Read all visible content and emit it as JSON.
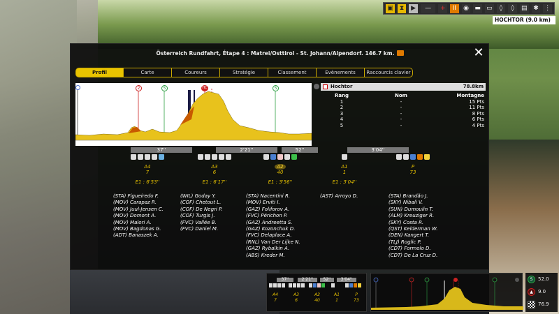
{
  "toolbar": {
    "location": "HOCHTOR (9.0 km)"
  },
  "panel": {
    "title": "Österreich Rundfahrt, Étape 4 : Matrei/Osttirol - St. Johann/Alpendorf. 146.7 km."
  },
  "tabs": [
    "Profil",
    "Carte",
    "Coureurs",
    "Stratégie",
    "Classement",
    "Evènements",
    "Raccourcis clavier"
  ],
  "active_tab": "Profil",
  "profile_markers": [
    "R",
    "2",
    "S",
    "HC",
    "S"
  ],
  "climb": {
    "name": "Hochtor",
    "distance": "78.8km",
    "columns": [
      "Rang",
      "Nom",
      "Montagne"
    ],
    "rows": [
      {
        "rank": "1",
        "name": "-",
        "points": "15 Pts"
      },
      {
        "rank": "2",
        "name": "-",
        "points": "11 Pts"
      },
      {
        "rank": "3",
        "name": "-",
        "points": "8 Pts"
      },
      {
        "rank": "4",
        "name": "-",
        "points": "6 Pts"
      },
      {
        "rank": "5",
        "name": "-",
        "points": "4 Pts"
      }
    ]
  },
  "gaps": [
    "37''",
    "2'21''",
    "52''",
    "3'04''"
  ],
  "groups": [
    {
      "code": "A4",
      "count": "7",
      "time": "E1 : 6'53''",
      "riders": [
        "(STA) Figueiredo F.",
        "(MOV) Carapaz R.",
        "(MOV) Juul-Jensen C.",
        "(MOV) Domont A.",
        "(MOV) Malori A.",
        "(MOV) Bagdonas G.",
        "(ADT) Banaszek A."
      ]
    },
    {
      "code": "A3",
      "count": "6",
      "time": "E1 : 6'17''",
      "riders": [
        "(WIL) Goday Y.",
        "(COF) Chetout L.",
        "(COF) De Negri P.",
        "(COF) Turgis J.",
        "(FVC) Vallée B.",
        "(FVC) Daniel M."
      ]
    },
    {
      "code": "A2",
      "count": "40",
      "time": "E1 : 3'56''",
      "riders": [
        "(STA) Nacentini R.",
        "(MOV) Erviti I.",
        "(GAZ) Foliforov A.",
        "(FVC) Périchon P.",
        "(GAZ) Andreetta S.",
        "(GAZ) Kozonchuk D.",
        "(FVC) Delaplace A.",
        "(RNL) Van Der Lijke N.",
        "(GAZ) Rybalkin A.",
        "(ABS) Kreder M."
      ]
    },
    {
      "code": "A1",
      "count": "1",
      "time": "E1 : 3'04''",
      "riders": [
        "(AST) Arroyo D."
      ]
    },
    {
      "code": "P",
      "count": "73",
      "time": "",
      "riders": [
        "(STA) Brandão J.",
        "(SKY) Nibali V.",
        "(SUN) Dumoulin T.",
        "(ALM) Kreuziger R.",
        "(SKY) Costa R.",
        "(QST) Kelderman W.",
        "(DEN) Kangert T.",
        "(TLJ) Roglic P.",
        "(CDT) Formolo D.",
        "(CDT) De La Cruz D."
      ]
    }
  ],
  "mini": {
    "gaps": [
      "37''",
      "2'21''",
      "52''",
      "3'04''"
    ],
    "codes": [
      "A4",
      "A3",
      "A2",
      "A1",
      "P"
    ],
    "counts": [
      "7",
      "6",
      "40",
      "1",
      "73"
    ]
  },
  "side_stats": {
    "sprint": "52.0",
    "mountain": "9.0",
    "finish": "76.9"
  },
  "colors": {
    "accent": "#e9c400",
    "profile_fill": "#e8c21c",
    "sprint_green": "#2ea043",
    "climb_red": "#cc2222"
  }
}
